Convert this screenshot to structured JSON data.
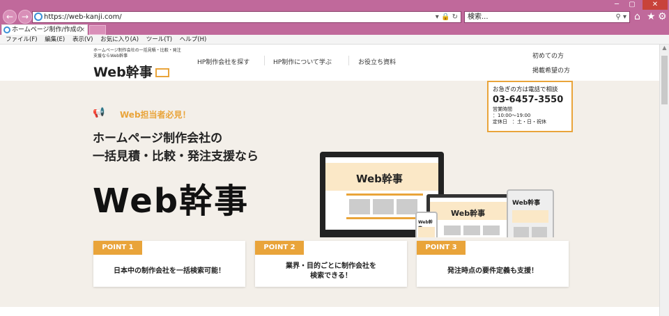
{
  "browser": {
    "url": "https://web-kanji.com/",
    "search_placeholder": "検索...",
    "tab_title": "ホームページ制作/作成の見...",
    "tab_close": "×",
    "back_icon": "←",
    "forward_icon": "→",
    "menu": [
      "ファイル(F)",
      "編集(E)",
      "表示(V)",
      "お気に入り(A)",
      "ツール(T)",
      "ヘルプ(H)"
    ]
  },
  "site": {
    "tagline": "ホームページ制作会社の一括見積・比較・発注支援ならWeb幹事",
    "logo": "Web幹事",
    "nav": [
      "HP制作会社を探す",
      "HP制作について学ぶ",
      "お役立ち資料"
    ],
    "right_links": [
      "初めての方",
      "掲載希望の方"
    ],
    "call": {
      "title": "お急ぎの方は電話で相談",
      "tel": "03-6457-3550",
      "hours_label": "営業時間",
      "hours": "：10:00〜19:00",
      "closed": "定休日　：土・日・祝休"
    }
  },
  "hero": {
    "badge": "Web担当者必見！",
    "headline1": "ホームページ制作会社の",
    "headline2": "一括見積・比較・発注支援なら",
    "logo": "Web幹事",
    "mock_logo": "Web幹事"
  },
  "points": [
    {
      "label": "POINT 1",
      "text": "日本中の制作会社を一括検索可能！"
    },
    {
      "label": "POINT 2",
      "text": "業界・目的ごとに制作会社を\n検索できる！"
    },
    {
      "label": "POINT 3",
      "text": "発注時点の要件定義も支援！"
    }
  ],
  "colors": {
    "chrome": "#c0699b",
    "accent": "#e9a43a",
    "hero_bg": "#f3efe9"
  }
}
